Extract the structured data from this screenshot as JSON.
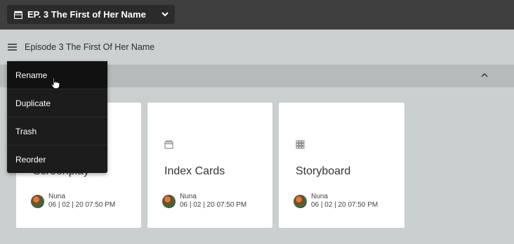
{
  "header": {
    "episode_select": "EP. 3 The First of Her Name",
    "episode_icon": "clapperboard-icon",
    "dropdown_icon": "chevron-down-icon"
  },
  "subheader": {
    "title": "Episode 3 The First Of Her Name",
    "menu_icon": "hamburger-icon"
  },
  "section": {
    "collapse_icon": "chevron-up-icon"
  },
  "cards": [
    {
      "title": "Screenplay",
      "icon": "document-icon",
      "author": "Nuna",
      "timestamp": "06 | 02 | 20 07:50 PM"
    },
    {
      "title": "Index Cards",
      "icon": "index-cards-icon",
      "author": "Nuna",
      "timestamp": "06 | 02 | 20 07:50 PM"
    },
    {
      "title": "Storyboard",
      "icon": "grid-icon",
      "author": "Nuna",
      "timestamp": "06 | 02 | 20 07:50 PM"
    }
  ],
  "context_menu": {
    "items": [
      {
        "label": "Rename"
      },
      {
        "label": "Duplicate"
      },
      {
        "label": "Trash"
      },
      {
        "label": "Reorder"
      }
    ],
    "hovered": "Rename"
  },
  "colors": {
    "topbar": "#3f3f3f",
    "background": "#cacfcf",
    "section_bar": "#b6baba",
    "menu": "#1c1c1c"
  }
}
